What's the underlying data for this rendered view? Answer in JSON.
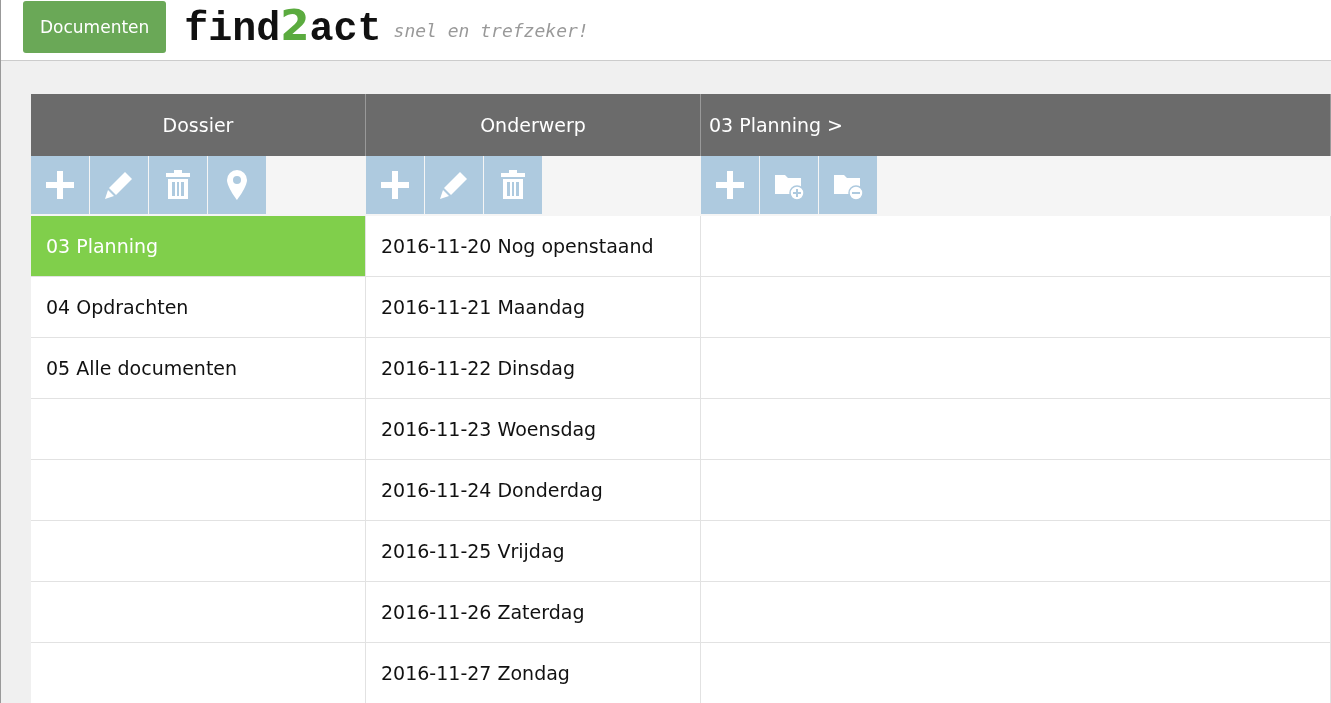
{
  "header": {
    "button": "Documenten",
    "logo": {
      "before": "find",
      "highlight": "2",
      "after": "act"
    },
    "tagline": "snel en trefzeker!"
  },
  "columns": [
    {
      "title": "Dossier",
      "kind": "center",
      "tools": [
        {
          "kind": "plus"
        },
        {
          "kind": "pencil"
        },
        {
          "kind": "trash"
        },
        {
          "kind": "pin"
        }
      ],
      "rows": [
        {
          "label": "03 Planning",
          "selected": true
        },
        {
          "label": "04 Opdrachten",
          "selected": false
        },
        {
          "label": "05 Alle documenten",
          "selected": false
        }
      ]
    },
    {
      "title": "Onderwerp",
      "kind": "center",
      "tools": [
        {
          "kind": "plus"
        },
        {
          "kind": "pencil"
        },
        {
          "kind": "trash"
        }
      ],
      "rows": [
        {
          "label": "2016-11-20 Nog openstaand",
          "selected": false
        },
        {
          "label": "2016-11-21 Maandag",
          "selected": false
        },
        {
          "label": "2016-11-22 Dinsdag",
          "selected": false
        },
        {
          "label": "2016-11-23 Woensdag",
          "selected": false
        },
        {
          "label": "2016-11-24 Donderdag",
          "selected": false
        },
        {
          "label": "2016-11-25 Vrijdag",
          "selected": false
        },
        {
          "label": "2016-11-26 Zaterdag",
          "selected": false
        },
        {
          "label": "2016-11-27 Zondag",
          "selected": false
        }
      ]
    },
    {
      "title": "03 Planning >",
      "kind": "left",
      "tools": [
        {
          "kind": "plus"
        },
        {
          "kind": "folder-plus"
        },
        {
          "kind": "folder-minus"
        }
      ]
    }
  ]
}
